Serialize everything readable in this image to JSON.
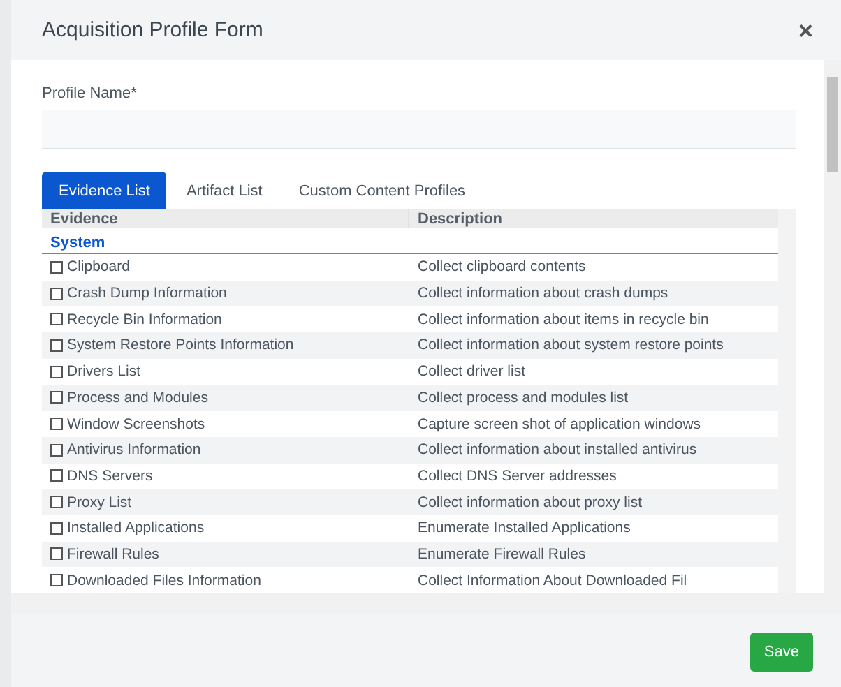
{
  "modal": {
    "title": "Acquisition Profile Form",
    "close": "×"
  },
  "profile_name": {
    "label": "Profile Name*"
  },
  "tabs": [
    {
      "label": "Evidence List",
      "selected": true
    },
    {
      "label": "Artifact List",
      "selected": false
    },
    {
      "label": "Custom Content Profiles",
      "selected": false
    }
  ],
  "table": {
    "columns": [
      "Evidence",
      "Description"
    ],
    "group": "System",
    "rows": [
      {
        "evidence": "Clipboard",
        "description": "Collect clipboard contents",
        "checked": false
      },
      {
        "evidence": "Crash Dump Information",
        "description": "Collect information about crash dumps",
        "checked": false
      },
      {
        "evidence": "Recycle Bin Information",
        "description": "Collect information about items in recycle bin",
        "checked": false
      },
      {
        "evidence": "System Restore Points Information",
        "description": "Collect information about system restore points",
        "checked": false
      },
      {
        "evidence": "Drivers List",
        "description": "Collect driver list",
        "checked": false
      },
      {
        "evidence": "Process and Modules",
        "description": "Collect process and modules list",
        "checked": false
      },
      {
        "evidence": "Window Screenshots",
        "description": "Capture screen shot of application windows",
        "checked": false
      },
      {
        "evidence": "Antivirus Information",
        "description": "Collect information about installed antivirus",
        "checked": false
      },
      {
        "evidence": "DNS Servers",
        "description": "Collect DNS Server addresses",
        "checked": false
      },
      {
        "evidence": "Proxy List",
        "description": "Collect information about proxy list",
        "checked": false
      },
      {
        "evidence": "Installed Applications",
        "description": "Enumerate Installed Applications",
        "checked": false
      },
      {
        "evidence": "Firewall Rules",
        "description": "Enumerate Firewall Rules",
        "checked": false
      },
      {
        "evidence": "Downloaded Files Information",
        "description": "Collect Information About Downloaded Fil",
        "checked": false
      }
    ]
  },
  "footer": {
    "save": "Save"
  }
}
